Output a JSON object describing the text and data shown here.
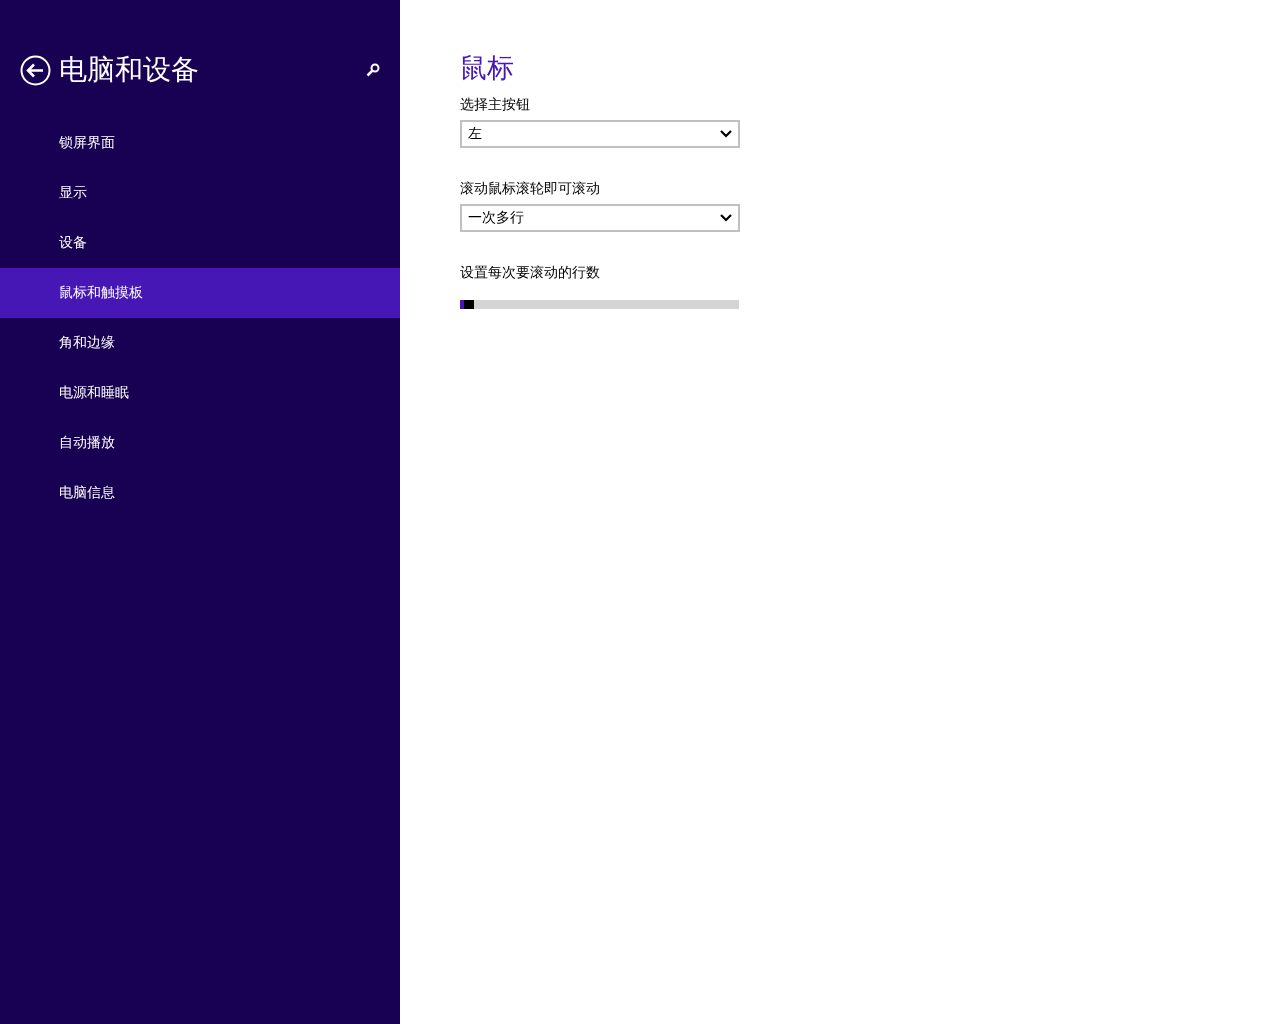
{
  "sidebar": {
    "title": "电脑和设备",
    "items": [
      {
        "label": "锁屏界面",
        "selected": false
      },
      {
        "label": "显示",
        "selected": false
      },
      {
        "label": "设备",
        "selected": false
      },
      {
        "label": "鼠标和触摸板",
        "selected": true
      },
      {
        "label": "角和边缘",
        "selected": false
      },
      {
        "label": "电源和睡眠",
        "selected": false
      },
      {
        "label": "自动播放",
        "selected": false
      },
      {
        "label": "电脑信息",
        "selected": false
      }
    ]
  },
  "content": {
    "title": "鼠标",
    "settings": [
      {
        "kind": "dropdown",
        "label": "选择主按钮",
        "value": "左"
      },
      {
        "kind": "dropdown",
        "label": "滚动鼠标滚轮即可滚动",
        "value": "一次多行"
      },
      {
        "kind": "slider",
        "label": "设置每次要滚动的行数",
        "level": 0.02
      }
    ]
  }
}
